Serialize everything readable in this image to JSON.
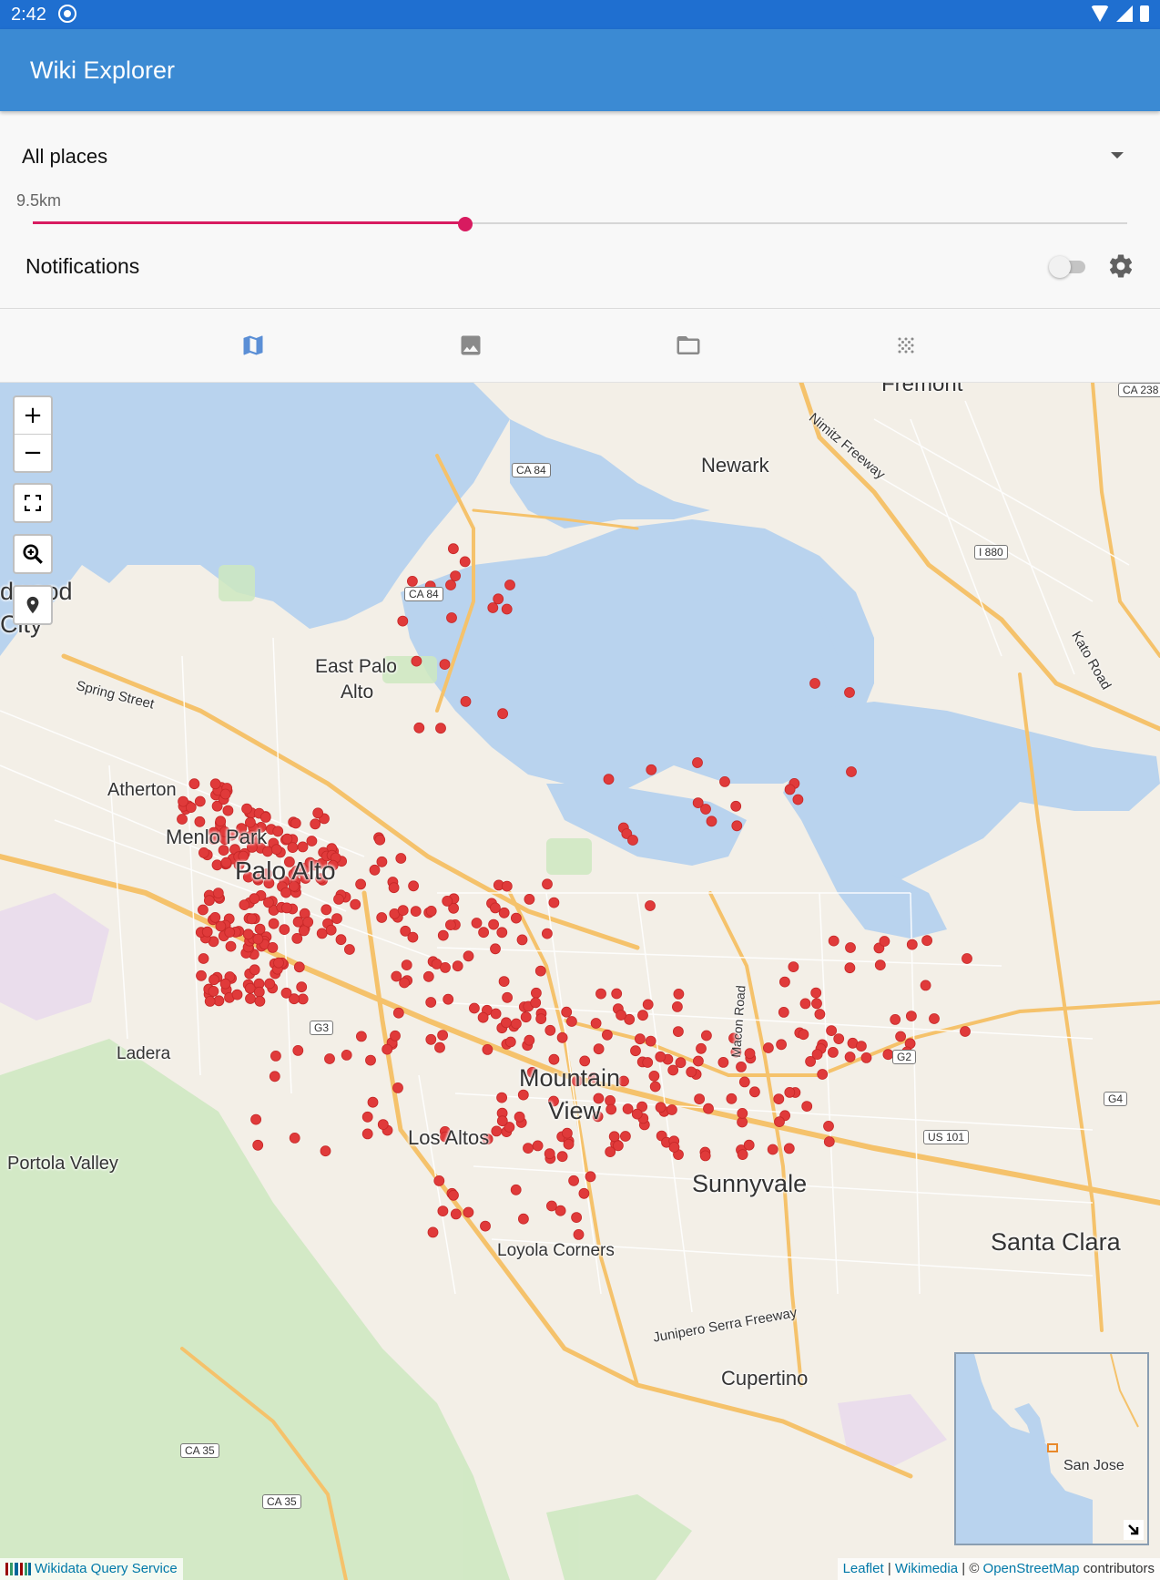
{
  "status_bar": {
    "time": "2:42"
  },
  "app_bar": {
    "title": "Wiki Explorer"
  },
  "filter": {
    "selected": "All places"
  },
  "radius": {
    "label": "9.5km",
    "fraction": 0.395
  },
  "notifications": {
    "label": "Notifications",
    "enabled": false
  },
  "tabs": [
    {
      "icon": "map-icon",
      "selected": true
    },
    {
      "icon": "image-icon",
      "selected": false
    },
    {
      "icon": "folder-icon",
      "selected": false
    },
    {
      "icon": "grid-dots-icon",
      "selected": false
    }
  ],
  "map": {
    "controls": {
      "zoom_in": "+",
      "zoom_out": "−"
    },
    "place_labels": [
      "Fremont",
      "Newark",
      "dwood",
      "City",
      "East Palo",
      "Alto",
      "Atherton",
      "Menlo Park",
      "Palo Alto",
      "Ladera",
      "Portola Valley",
      "Mountain",
      "View",
      "Los Altos",
      "Sunnyvale",
      "Loyola Corners",
      "Santa Clara",
      "Cupertino",
      "San Jose"
    ],
    "road_labels": [
      "CA 84",
      "CA 84",
      "I 880",
      "CA 238",
      "US 101",
      "G3",
      "G2",
      "G4",
      "CA 35",
      "CA 35",
      "Spring Street",
      "Nimitz Freeway",
      "Kato Road",
      "Macon Road",
      "Junipero Serra Freeway"
    ],
    "attribution": {
      "wikidata": "Wikidata Query Service",
      "leaflet": "Leaflet",
      "sep1": "|",
      "wikimedia": "Wikimedia",
      "sep2": "| ©",
      "osm": "OpenStreetMap",
      "contributors": "contributors"
    },
    "marker_color": "#e03a3a"
  },
  "colors": {
    "app_bar": "#3b8ad3",
    "status_bar": "#1f6fd0",
    "slider_accent": "#d81b60",
    "water": "#b9d3ee"
  }
}
